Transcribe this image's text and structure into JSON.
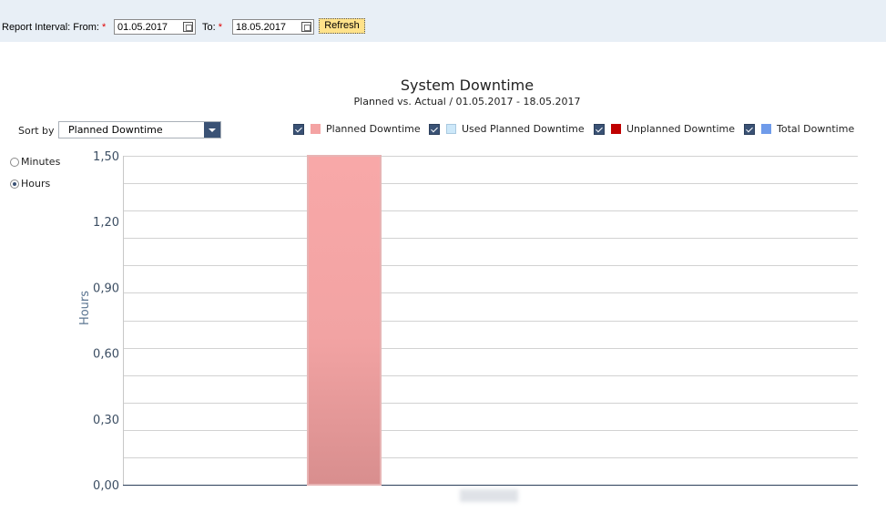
{
  "report": {
    "interval_label": "Report Interval: From:",
    "from_value": "01.05.2017",
    "to_label": "To:",
    "to_value": "18.05.2017",
    "required_mark": "*",
    "refresh_label": "Refresh"
  },
  "controls": {
    "sort_label": "Sort by",
    "sort_value": "Planned Downtime",
    "unit_options": [
      {
        "label": "Minutes",
        "selected": false
      },
      {
        "label": "Hours",
        "selected": true
      }
    ]
  },
  "legend": [
    {
      "label": "Planned Downtime",
      "color": "#f4a3a3",
      "checked": true
    },
    {
      "label": "Used Planned Downtime",
      "color": "#cde8f9",
      "checked": true
    },
    {
      "label": "Unplanned Downtime",
      "color": "#c00000",
      "checked": true
    },
    {
      "label": "Total Downtime",
      "color": "#6f9bea",
      "checked": true
    }
  ],
  "chart_data": {
    "type": "bar",
    "title": "System Downtime",
    "subtitle": "Planned vs. Actual / 01.05.2017 - 18.05.2017",
    "ylabel": "Hours",
    "xlabel": "",
    "ylim": [
      0,
      1.5
    ],
    "yticks": [
      "0,00",
      "0,30",
      "0,60",
      "0,90",
      "1,20",
      "1,50"
    ],
    "grid": true,
    "legend_position": "top-right",
    "categories": [
      ""
    ],
    "series": [
      {
        "name": "Planned Downtime",
        "color": "#f4a3a3",
        "values": [
          1.5
        ]
      }
    ]
  }
}
